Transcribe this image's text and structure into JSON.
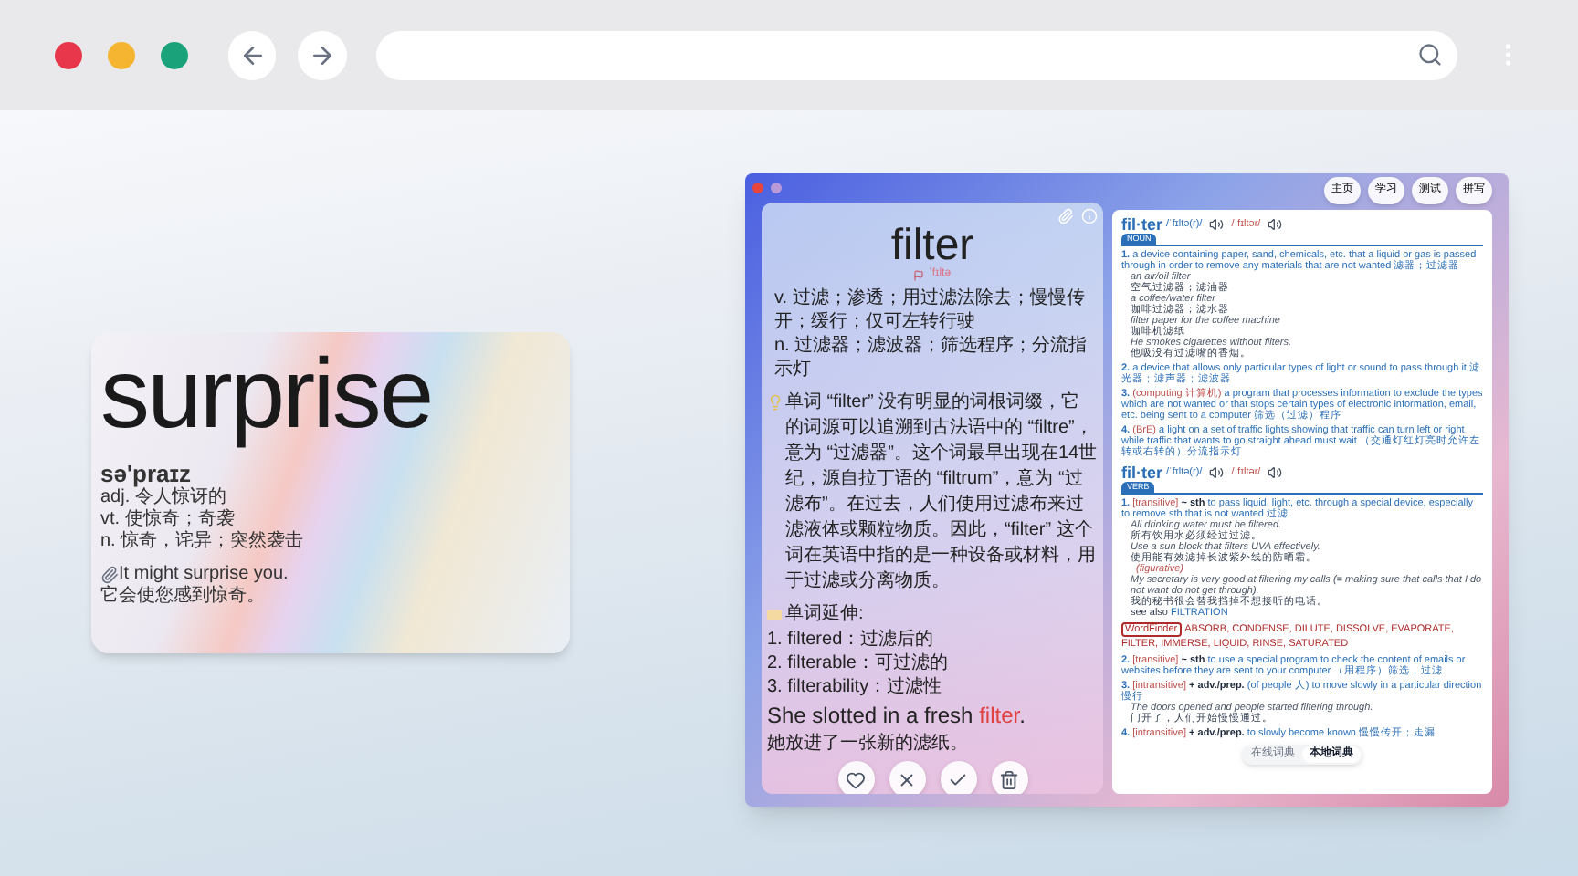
{
  "browser": {
    "traffic_lights": [
      {
        "color": "#e8364a"
      },
      {
        "color": "#f5b530"
      },
      {
        "color": "#1aa37a"
      }
    ]
  },
  "word_card": {
    "word": "surprise",
    "phonetic": "sə'praɪz",
    "definitions": [
      "adj. 令人惊讶的",
      "vt. 使惊奇；奇袭",
      "n. 惊奇，诧异；突然袭击"
    ],
    "example_en": "It might surprise you.",
    "example_zh": "它会使您感到惊奇。"
  },
  "app": {
    "word": "filter",
    "phonetic": "ˈfɪltə",
    "definitions": [
      "v. 过滤；渗透；用过滤法除去；慢慢传开；缓行；仅可左转行驶",
      "n. 过滤器；滤波器；筛选程序；分流指示灯"
    ],
    "note": "单词 “filter” 没有明显的词根词缀，它的词源可以追溯到古法语中的 “filtre”，意为 “过滤器”。这个词最早出现在14世纪，源自拉丁语的 “filtrum”，意为 “过滤布”。在过去，人们使用过滤布来过滤液体或颗粒物质。因此，“filter” 这个词在英语中指的是一种设备或材料，用于过滤或分离物质。",
    "extension_title": "单词延伸:",
    "extensions": [
      "1. filtered：过滤后的",
      "2. filterable：可过滤的",
      "3. filterability：过滤性"
    ],
    "example": {
      "before": "She slotted in a fresh ",
      "highlight": "filter",
      "after": ".",
      "zh": "她放进了一张新的滤纸。"
    },
    "nav_tabs": [
      "主页",
      "学习",
      "测试",
      "拼写"
    ],
    "dictionary": [
      {
        "headword": "fil·ter",
        "phon_uk": "/ˈfɪltə(r)/",
        "phon_us": "/ˈfɪltər/",
        "pos": "NOUN",
        "items": [
          {
            "kind": "sense",
            "num": "1.",
            "text": "a device containing paper, sand, chemicals, etc. that a liquid or gas is passed through in order to remove any materials that are not wanted",
            "zh": "滤器；过滤器"
          },
          {
            "kind": "example",
            "en": "an air/oil filter",
            "zh": "空气过滤器；滤油器"
          },
          {
            "kind": "example",
            "en": "a coffee/water filter",
            "zh": "咖啡过滤器；滤水器"
          },
          {
            "kind": "example",
            "en": "filter paper for the coffee machine",
            "zh": "咖啡机滤纸"
          },
          {
            "kind": "example",
            "en": "He smokes cigarettes without filters.",
            "zh": "他吸没有过滤嘴的香烟。"
          },
          {
            "kind": "sense",
            "num": "2.",
            "text": "a device that allows only particular types of light or sound to pass through it",
            "zh": "滤光器；滤声器；滤波器"
          },
          {
            "kind": "sense",
            "num": "3.",
            "label": "(computing 计算机)",
            "text": "a program that processes information to exclude the types which are not wanted or that stops certain types of electronic information, email, etc. being sent to a computer",
            "zh": "筛选（过滤）程序"
          },
          {
            "kind": "sense",
            "num": "4.",
            "label": "(BrE)",
            "text": "a light on a set of traffic lights showing that traffic can turn left or right while traffic that wants to go straight ahead must wait",
            "zh": "（交通灯红灯亮时允许左转或右转的）分流指示灯"
          }
        ]
      },
      {
        "headword": "fil·ter",
        "phon_uk": "/ˈfɪltə(r)/",
        "phon_us": "/ˈfɪltər/",
        "pos": "VERB",
        "items": [
          {
            "kind": "sense",
            "num": "1.",
            "label": "[transitive]",
            "pattern": "~ sth",
            "text": "to pass liquid, light, etc. through a special device, especially to remove sth that is not wanted",
            "zh": "过滤"
          },
          {
            "kind": "example",
            "en": "All drinking water must be filtered.",
            "zh": "所有饮用水必须经过过滤。"
          },
          {
            "kind": "example",
            "en": "Use a sun block that filters UVA effectively.",
            "zh": "使用能有效滤掉长波紫外线的防晒霜。"
          },
          {
            "kind": "label",
            "text": "(figurative)"
          },
          {
            "kind": "example",
            "en": "My secretary is very good at filtering my calls (= making sure that calls that I do not want do not get through).",
            "zh": "我的秘书很会替我挡掉不想接听的电话。"
          },
          {
            "kind": "seealso",
            "text": "see also",
            "link": "FILTRATION"
          },
          {
            "kind": "wordfinder",
            "label": "WordFinder",
            "words": "ABSORB, CONDENSE, DILUTE, DISSOLVE, EVAPORATE, FILTER, IMMERSE, LIQUID, RINSE, SATURATED"
          },
          {
            "kind": "sense",
            "num": "2.",
            "label": "[transitive]",
            "pattern": "~ sth",
            "text": "to use a special program to check the content of emails or websites before they are sent to your computer",
            "zh": "（用程序）筛选，过滤"
          },
          {
            "kind": "sense",
            "num": "3.",
            "label": "[intransitive]",
            "pattern": "+ adv./prep.",
            "text": "(of people 人) to move slowly in a particular direction",
            "zh": "慢行"
          },
          {
            "kind": "example",
            "en": "The doors opened and people started filtering through.",
            "zh": "门开了，人们开始慢慢通过。"
          },
          {
            "kind": "sense",
            "num": "4.",
            "label": "[intransitive]",
            "pattern": "+ adv./prep.",
            "text": "to slowly become known",
            "zh": "慢慢传开；走漏"
          }
        ]
      }
    ],
    "source_toggle": [
      {
        "label": "在线词典",
        "selected": false
      },
      {
        "label": "本地词典",
        "selected": true
      }
    ]
  }
}
